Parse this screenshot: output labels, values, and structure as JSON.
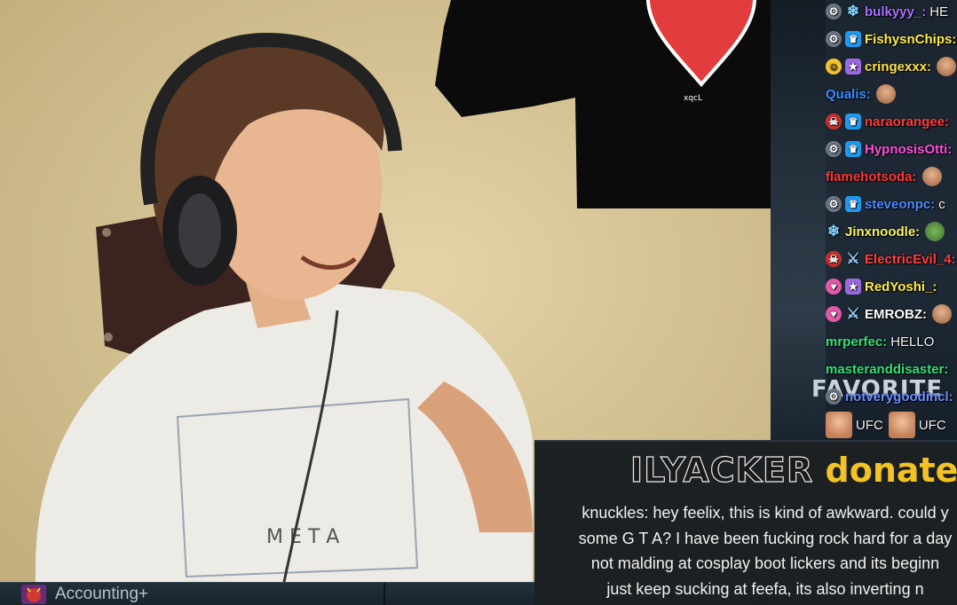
{
  "chat": {
    "backdrop_text": "FAVORITE",
    "lines": [
      {
        "badges": [
          "robot",
          "snow"
        ],
        "user": "bulkyyy_",
        "color": "#a970ff",
        "message": "HE"
      },
      {
        "badges": [
          "robot",
          "crown"
        ],
        "user": "FishysnChips",
        "color": "#ffea4a",
        "message": ""
      },
      {
        "badges": [
          "emoji",
          "purple"
        ],
        "user": "cringexxx",
        "color": "#ffe34d",
        "message": ""
      },
      {
        "badges": [],
        "user": "Qualis",
        "color": "#3d8bff",
        "message": ""
      },
      {
        "badges": [
          "demon",
          "crown"
        ],
        "user": "naraorangee",
        "color": "#ff3d3d",
        "message": ""
      },
      {
        "badges": [
          "robot",
          "crown"
        ],
        "user": "HypnosisOtti",
        "color": "#ff4fd8",
        "message": ""
      },
      {
        "badges": [],
        "user": "flamehotsoda",
        "color": "#ff3838",
        "message": ""
      },
      {
        "badges": [
          "robot",
          "crown"
        ],
        "user": "steveonpc",
        "color": "#4a8cff",
        "message": "c"
      },
      {
        "badges": [
          "snow"
        ],
        "user": "Jinxnoodle",
        "color": "#f8f56a",
        "message": ""
      },
      {
        "badges": [
          "demon",
          "sword"
        ],
        "user": "ElectricEvil_4",
        "color": "#ff4040",
        "message": ""
      },
      {
        "badges": [
          "pink",
          "purple"
        ],
        "user": "RedYoshi_",
        "color": "#ffea4a",
        "message": ""
      },
      {
        "badges": [
          "pink",
          "sword"
        ],
        "user": "EMROBZ",
        "color": "#ffffff",
        "message": ""
      },
      {
        "badges": [],
        "user": "mrperfec",
        "color": "#38e07a",
        "message": "HELLO"
      },
      {
        "badges": [],
        "user": "masteranddisaster",
        "color": "#38e07a",
        "message": ""
      },
      {
        "badges": [
          "robot"
        ],
        "user": "notverygoodincl",
        "color": "#6f8cff",
        "message": ""
      }
    ],
    "ufc_line": {
      "emote_text_1": "UFC",
      "emote_text_2": "UFC"
    }
  },
  "donation": {
    "donor": "ILYACKER",
    "donated_text": "donated $",
    "message_lines": [
      "knuckles: hey feelix, this is kind of awkward. could y",
      "some G T A? I have been fucking rock hard for a day",
      "not malding at cosplay boot lickers and its beginn",
      "just keep sucking at feefa, its also inverting n"
    ]
  },
  "bottom_bar": {
    "label": "Accounting+"
  },
  "colors": {
    "donated": "#f3c224",
    "chat_bg": "#1e2a36",
    "wall": "#d9c79b"
  }
}
